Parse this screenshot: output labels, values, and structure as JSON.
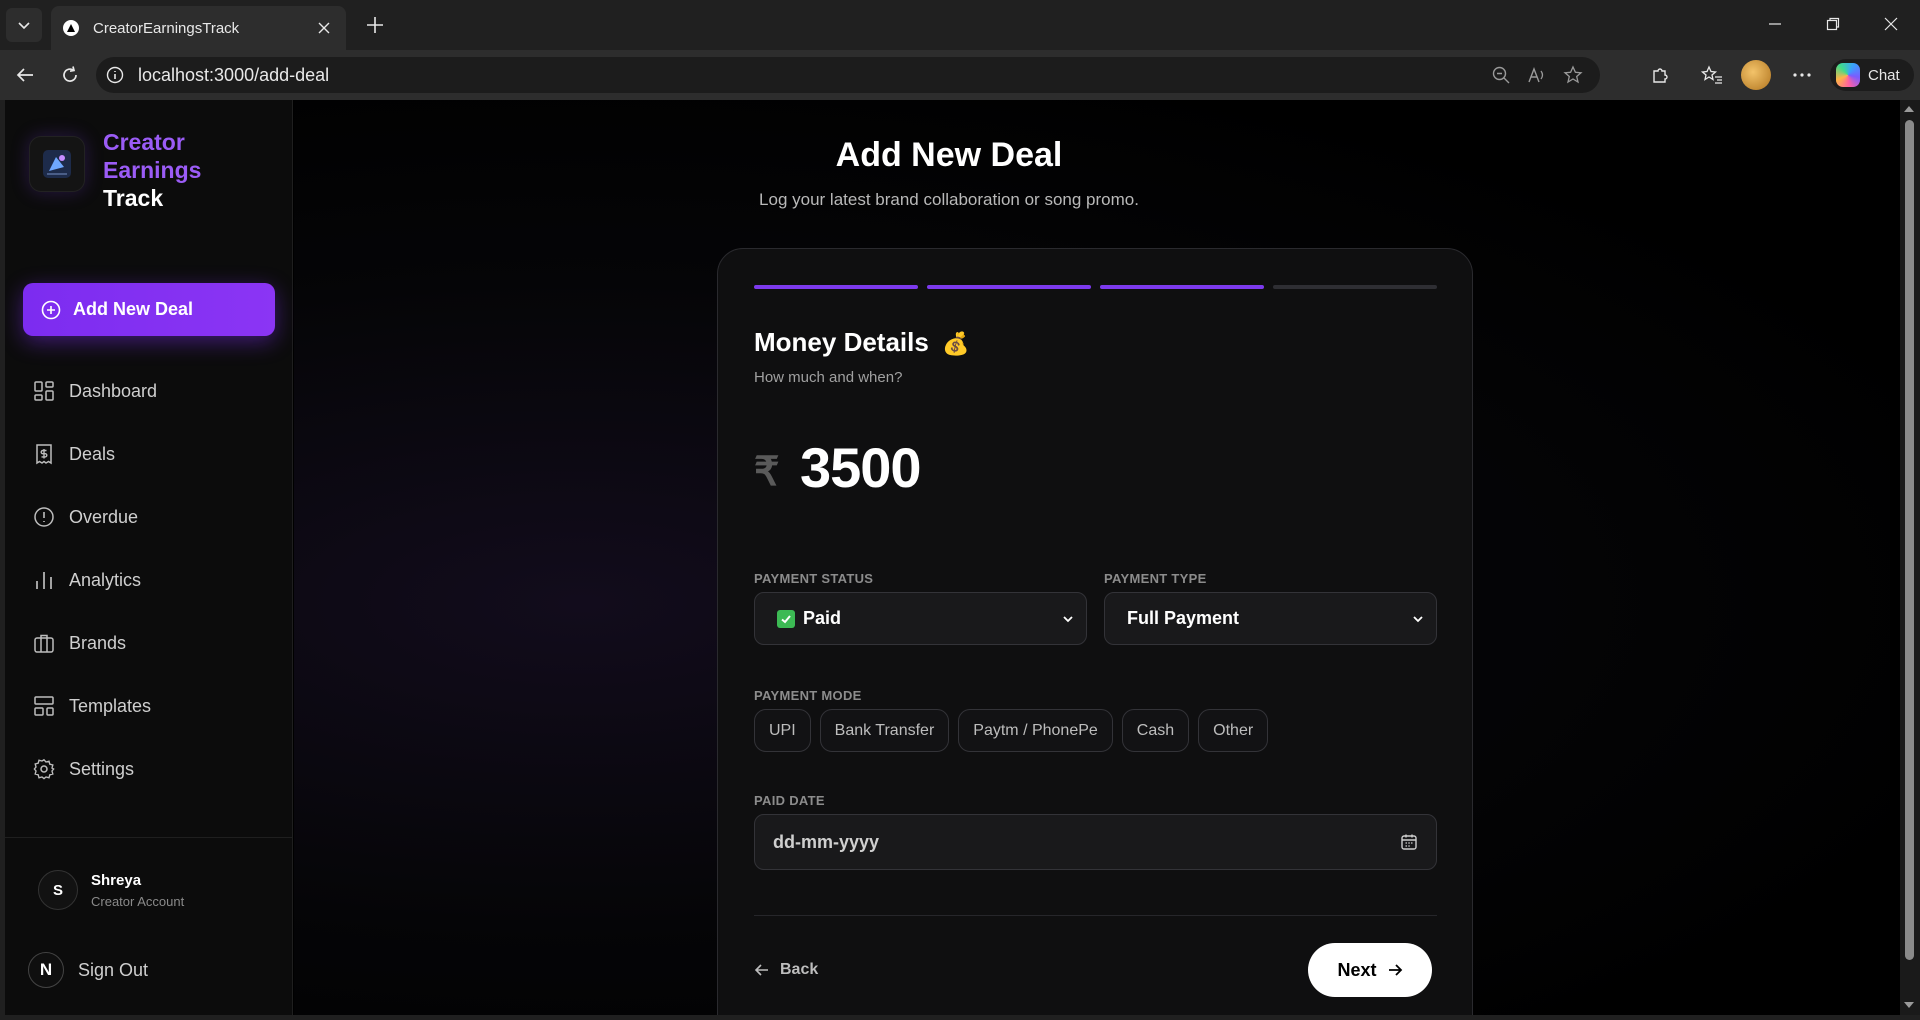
{
  "browser": {
    "tab_title": "CreatorEarningsTrack",
    "url": "localhost:3000/add-deal",
    "copilot_label": "Chat"
  },
  "sidebar": {
    "brand_line1": "Creator",
    "brand_line2": "Earnings",
    "brand_line3": "Track",
    "add_deal_label": "Add New Deal",
    "items": [
      {
        "label": "Dashboard",
        "icon": "grid-icon"
      },
      {
        "label": "Deals",
        "icon": "receipt-dollar-icon"
      },
      {
        "label": "Overdue",
        "icon": "alert-circle-icon"
      },
      {
        "label": "Analytics",
        "icon": "bar-chart-icon"
      },
      {
        "label": "Brands",
        "icon": "briefcase-icon"
      },
      {
        "label": "Templates",
        "icon": "layout-icon"
      },
      {
        "label": "Settings",
        "icon": "gear-icon"
      }
    ],
    "user": {
      "initial": "S",
      "name": "Shreya",
      "role": "Creator Account"
    },
    "signout_badge": "N",
    "signout_label": "Sign Out"
  },
  "page": {
    "title": "Add New Deal",
    "subtitle": "Log your latest brand collaboration or song promo."
  },
  "form": {
    "progress": {
      "completed_steps": 3,
      "total_steps": 4
    },
    "step_title": "Money Details",
    "step_emoji": "💰",
    "step_subtitle": "How much and when?",
    "currency_symbol": "₹",
    "amount": "3500",
    "payment_status": {
      "label": "PAYMENT STATUS",
      "value": "Paid"
    },
    "payment_type": {
      "label": "PAYMENT TYPE",
      "value": "Full Payment"
    },
    "payment_mode": {
      "label": "PAYMENT MODE",
      "options": [
        "UPI",
        "Bank Transfer",
        "Paytm / PhonePe",
        "Cash",
        "Other"
      ]
    },
    "paid_date": {
      "label": "PAID DATE",
      "placeholder": "dd-mm-yyyy"
    },
    "back_label": "Back",
    "next_label": "Next"
  },
  "colors": {
    "accent": "#7c3aed",
    "brand_purple": "#9b5cf6",
    "background": "#000000"
  }
}
